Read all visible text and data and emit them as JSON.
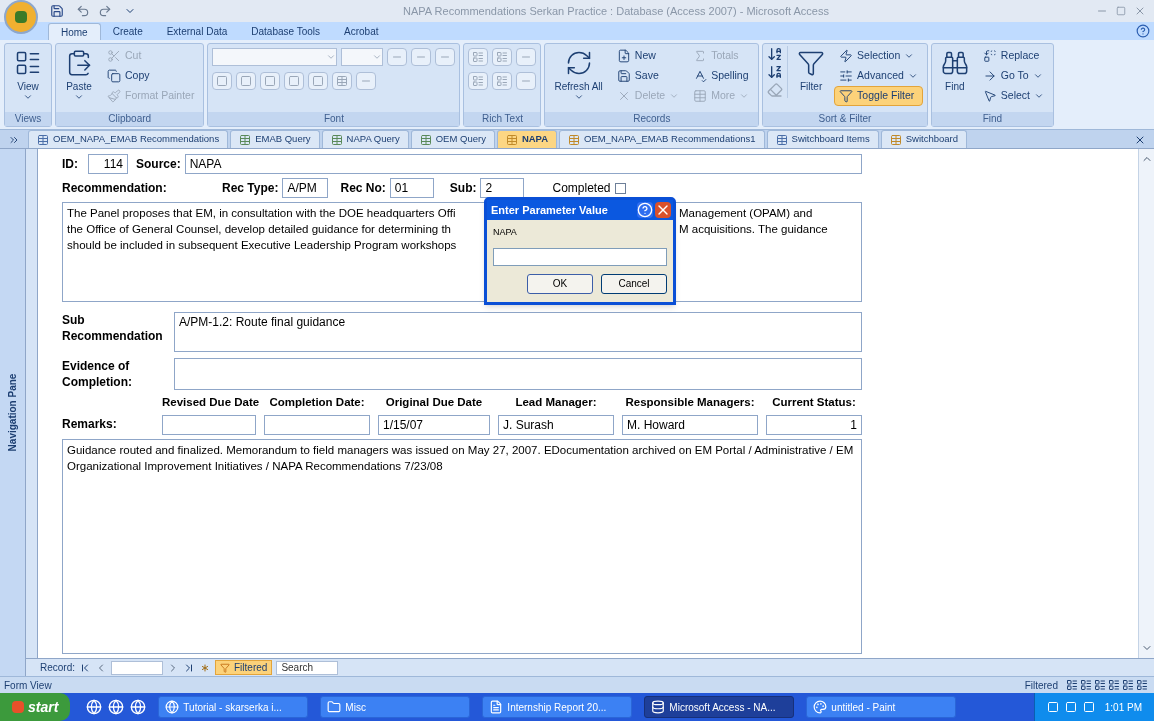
{
  "window": {
    "title": "NAPA Recommendations Serkan Practice : Database (Access 2007) - Microsoft Access"
  },
  "ribbon_tabs": [
    {
      "label": "Home",
      "selected": true
    },
    {
      "label": "Create",
      "selected": false
    },
    {
      "label": "External Data",
      "selected": false
    },
    {
      "label": "Database Tools",
      "selected": false
    },
    {
      "label": "Acrobat",
      "selected": false
    }
  ],
  "ribbon_groups": [
    {
      "name": "Views",
      "kind": "standard",
      "items": [
        {
          "label": "View",
          "kind": "large",
          "disabled": false,
          "active": false,
          "dropdown": true
        }
      ]
    },
    {
      "name": "Clipboard",
      "kind": "standard",
      "items": [
        {
          "label": "Paste",
          "kind": "large",
          "disabled": false,
          "active": false,
          "dropdown": true
        },
        {
          "label": "Cut",
          "kind": "small",
          "disabled": true,
          "active": false,
          "dropdown": false
        },
        {
          "label": "Copy",
          "kind": "small",
          "disabled": false,
          "active": false,
          "dropdown": false
        },
        {
          "label": "Format Painter",
          "kind": "small",
          "disabled": true,
          "active": false,
          "dropdown": false
        }
      ]
    },
    {
      "name": "Font",
      "kind": "font"
    },
    {
      "name": "Rich Text",
      "kind": "richtext"
    },
    {
      "name": "Records",
      "kind": "standard",
      "items": [
        {
          "label": "Refresh All",
          "kind": "large",
          "disabled": false,
          "active": false,
          "dropdown": true
        },
        {
          "label": "New",
          "kind": "small",
          "disabled": false,
          "active": false,
          "dropdown": false
        },
        {
          "label": "Save",
          "kind": "small",
          "disabled": false,
          "active": false,
          "dropdown": false
        },
        {
          "label": "Delete",
          "kind": "small",
          "disabled": true,
          "active": false,
          "dropdown": true
        },
        {
          "label": "Totals",
          "kind": "small",
          "disabled": true,
          "active": false,
          "dropdown": false
        },
        {
          "label": "Spelling",
          "kind": "small",
          "disabled": false,
          "active": false,
          "dropdown": false
        },
        {
          "label": "More",
          "kind": "small",
          "disabled": true,
          "active": false,
          "dropdown": true
        }
      ]
    },
    {
      "name": "Sort & Filter",
      "kind": "sort",
      "items": [
        {
          "label": "Filter",
          "kind": "large",
          "disabled": false,
          "active": false,
          "dropdown": false
        },
        {
          "label": "Selection",
          "kind": "small",
          "disabled": false,
          "active": false,
          "dropdown": true
        },
        {
          "label": "Advanced",
          "kind": "small",
          "disabled": false,
          "active": false,
          "dropdown": true
        },
        {
          "label": "Toggle Filter",
          "kind": "small",
          "disabled": false,
          "active": true,
          "dropdown": false
        }
      ]
    },
    {
      "name": "Find",
      "kind": "standard",
      "items": [
        {
          "label": "Find",
          "kind": "large",
          "disabled": false,
          "active": false,
          "dropdown": false
        },
        {
          "label": "Replace",
          "kind": "small",
          "disabled": false,
          "active": false,
          "dropdown": false
        },
        {
          "label": "Go To",
          "kind": "small",
          "disabled": false,
          "active": false,
          "dropdown": true
        },
        {
          "label": "Select",
          "kind": "small",
          "disabled": false,
          "active": false,
          "dropdown": true
        }
      ]
    }
  ],
  "doc_tabs": [
    {
      "label": "OEM_NAPA_EMAB Recommendations",
      "kind": "table",
      "selected": false
    },
    {
      "label": "EMAB Query",
      "kind": "query",
      "selected": false
    },
    {
      "label": "NAPA Query",
      "kind": "query",
      "selected": false
    },
    {
      "label": "OEM Query",
      "kind": "query",
      "selected": false
    },
    {
      "label": "NAPA",
      "kind": "form",
      "selected": true
    },
    {
      "label": "OEM_NAPA_EMAB Recommendations1",
      "kind": "form",
      "selected": false
    },
    {
      "label": "Switchboard Items",
      "kind": "table",
      "selected": false
    },
    {
      "label": "Switchboard",
      "kind": "form",
      "selected": false
    }
  ],
  "nav_pane": {
    "label": "Navigation Pane"
  },
  "form": {
    "id_label": "ID:",
    "id": "114",
    "source_label": "Source:",
    "source": "NAPA",
    "recommendation_label": "Recommendation:",
    "rec_type_label": "Rec Type:",
    "rec_type": "A/PM",
    "rec_no_label": "Rec No:",
    "rec_no": "01",
    "sub_label": "Sub:",
    "sub": "2",
    "completed_label": "Completed",
    "completed": false,
    "recommendation_lines": [
      {
        "left": "The Panel proposes that EM, in consultation with the DOE headquarters Offi",
        "right": "Management (OPAM) and"
      },
      {
        "left": "the Office of General Counsel, develop detailed guidance for determining th",
        "right": "M acquisitions. The guidance"
      },
      {
        "left": "should be included in subsequent Executive Leadership Program workshops"
      }
    ],
    "sub_recommendation_label": "Sub Recommendation",
    "sub_recommendation": "A/PM-1.2:  Route final guidance",
    "evidence_label": "Evidence of Completion:",
    "remarks_label": "Remarks:",
    "columns": [
      {
        "label": "Revised Due Date",
        "kind": "text"
      },
      {
        "label": "Completion Date:",
        "kind": "text"
      },
      {
        "label": "Original Due Date",
        "value": "1/15/07",
        "kind": "text"
      },
      {
        "label": "Lead Manager:",
        "value": "J. Surash",
        "kind": "text"
      },
      {
        "label": "Responsible Managers:",
        "value": "M. Howard",
        "kind": "text"
      },
      {
        "label": "Current Status:",
        "value": "1",
        "kind": "number"
      }
    ],
    "remarks": "Guidance routed and finalized.  Memorandum to field managers was issued on May 27, 2007.  EDocumentation archived on EM Portal / Administrative / EM Organizational Improvement Initiatives / NAPA Recommendations 7/23/08"
  },
  "dialog": {
    "title": "Enter Parameter Value",
    "prompt": "NAPA",
    "buttons": [
      "OK",
      "Cancel"
    ]
  },
  "record_nav": {
    "label": "Record:",
    "filter": "Filtered",
    "filter_active": true,
    "search_placeholder": "Search"
  },
  "status_bar": {
    "view": "Form View",
    "filter": "Filtered"
  },
  "taskbar": {
    "start": "start",
    "items": [
      {
        "label": "Tutorial - skarserka i...",
        "kind": "browser",
        "selected": false
      },
      {
        "label": "Misc",
        "kind": "folder",
        "selected": false
      },
      {
        "label": "Internship Report 20...",
        "kind": "document",
        "selected": false
      },
      {
        "label": "Microsoft Access - NA...",
        "kind": "access",
        "selected": true
      },
      {
        "label": "untitled - Paint",
        "kind": "paint",
        "selected": false
      }
    ],
    "clock": "1:01 PM"
  }
}
